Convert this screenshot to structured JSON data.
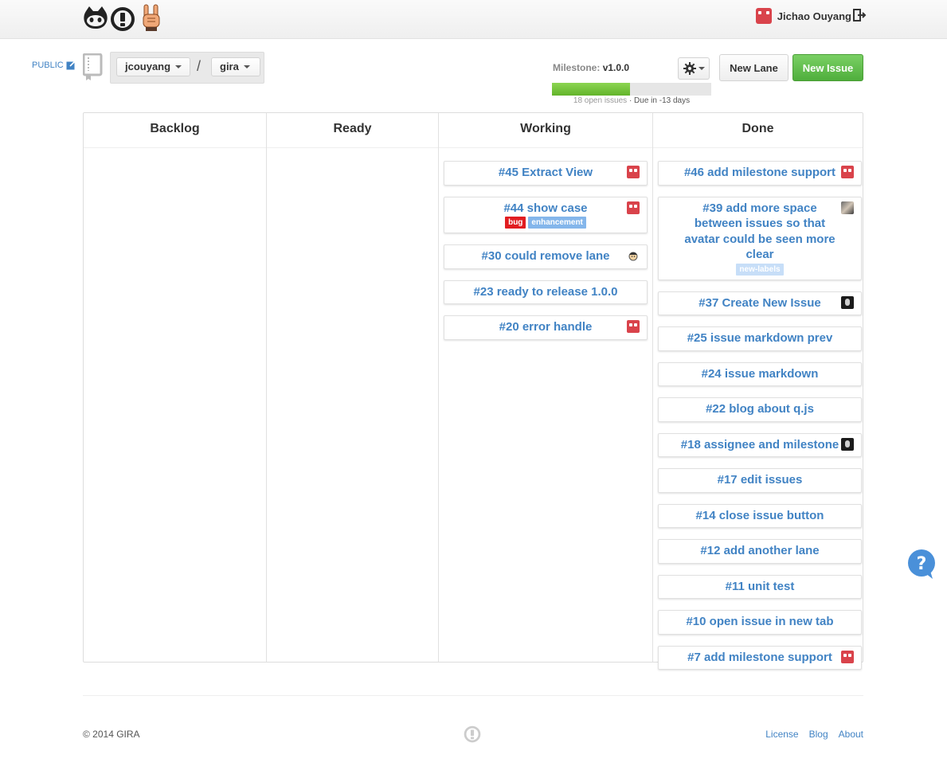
{
  "header": {
    "logos": [
      "octocat-icon",
      "gira-logo-icon",
      "rock-hand-icon"
    ],
    "user_name": "Jichao Ouyang",
    "logout_icon": "sign-out-icon"
  },
  "repo": {
    "visibility": "PUBLIC",
    "owner": "jcouyang",
    "separator": "/",
    "name": "gira"
  },
  "milestone": {
    "label": "Milestone:",
    "version": "v1.0.0",
    "progress_percent": 49,
    "open_issues": "18 open issues",
    "due": "· Due in -13 days",
    "progress_color": "#6cc644"
  },
  "toolbar": {
    "settings_icon": "gear-icon",
    "new_lane": "New Lane",
    "new_issue": "New Issue"
  },
  "lanes": [
    {
      "title": "Backlog",
      "cards": []
    },
    {
      "title": "Ready",
      "cards": []
    },
    {
      "title": "Working",
      "cards": [
        {
          "title": "#45 Extract View",
          "avatar": "robot",
          "labels": []
        },
        {
          "title": "#44 show case",
          "avatar": "robot",
          "labels": [
            {
              "text": "bug",
              "color": "#e11d21"
            },
            {
              "text": "enhancement",
              "color": "#84b6eb"
            }
          ]
        },
        {
          "title": "#30 could remove lane",
          "avatar": "face",
          "labels": []
        },
        {
          "title": "#23 ready to release 1.0.0",
          "avatar": "",
          "labels": []
        },
        {
          "title": "#20 error handle",
          "avatar": "robot",
          "labels": []
        }
      ]
    },
    {
      "title": "Done",
      "cards": [
        {
          "title": "#46 add milestone support",
          "avatar": "robot",
          "labels": []
        },
        {
          "title": "#39 add more space between issues so that avatar could be seen more clear",
          "avatar": "photo",
          "labels": [
            {
              "text": "new-labels",
              "color": "#c7def8"
            }
          ]
        },
        {
          "title": "#37 Create New Issue",
          "avatar": "dark",
          "labels": []
        },
        {
          "title": "#25 issue markdown prev",
          "avatar": "",
          "labels": []
        },
        {
          "title": "#24 issue markdown",
          "avatar": "",
          "labels": []
        },
        {
          "title": "#22 blog about q.js",
          "avatar": "",
          "labels": []
        },
        {
          "title": "#18 assignee and milestone",
          "avatar": "dark",
          "labels": []
        },
        {
          "title": "#17 edit issues",
          "avatar": "",
          "labels": []
        },
        {
          "title": "#14 close issue button",
          "avatar": "",
          "labels": []
        },
        {
          "title": "#12 add another lane",
          "avatar": "",
          "labels": []
        },
        {
          "title": "#11 unit test",
          "avatar": "",
          "labels": []
        },
        {
          "title": "#10 open issue in new tab",
          "avatar": "",
          "labels": []
        },
        {
          "title": "#7 add milestone support",
          "avatar": "robot",
          "labels": []
        }
      ]
    }
  ],
  "footer": {
    "copyright": "© 2014 GIRA",
    "links": [
      "License",
      "Blog",
      "About"
    ]
  },
  "help_icon": "question-bubble-icon"
}
